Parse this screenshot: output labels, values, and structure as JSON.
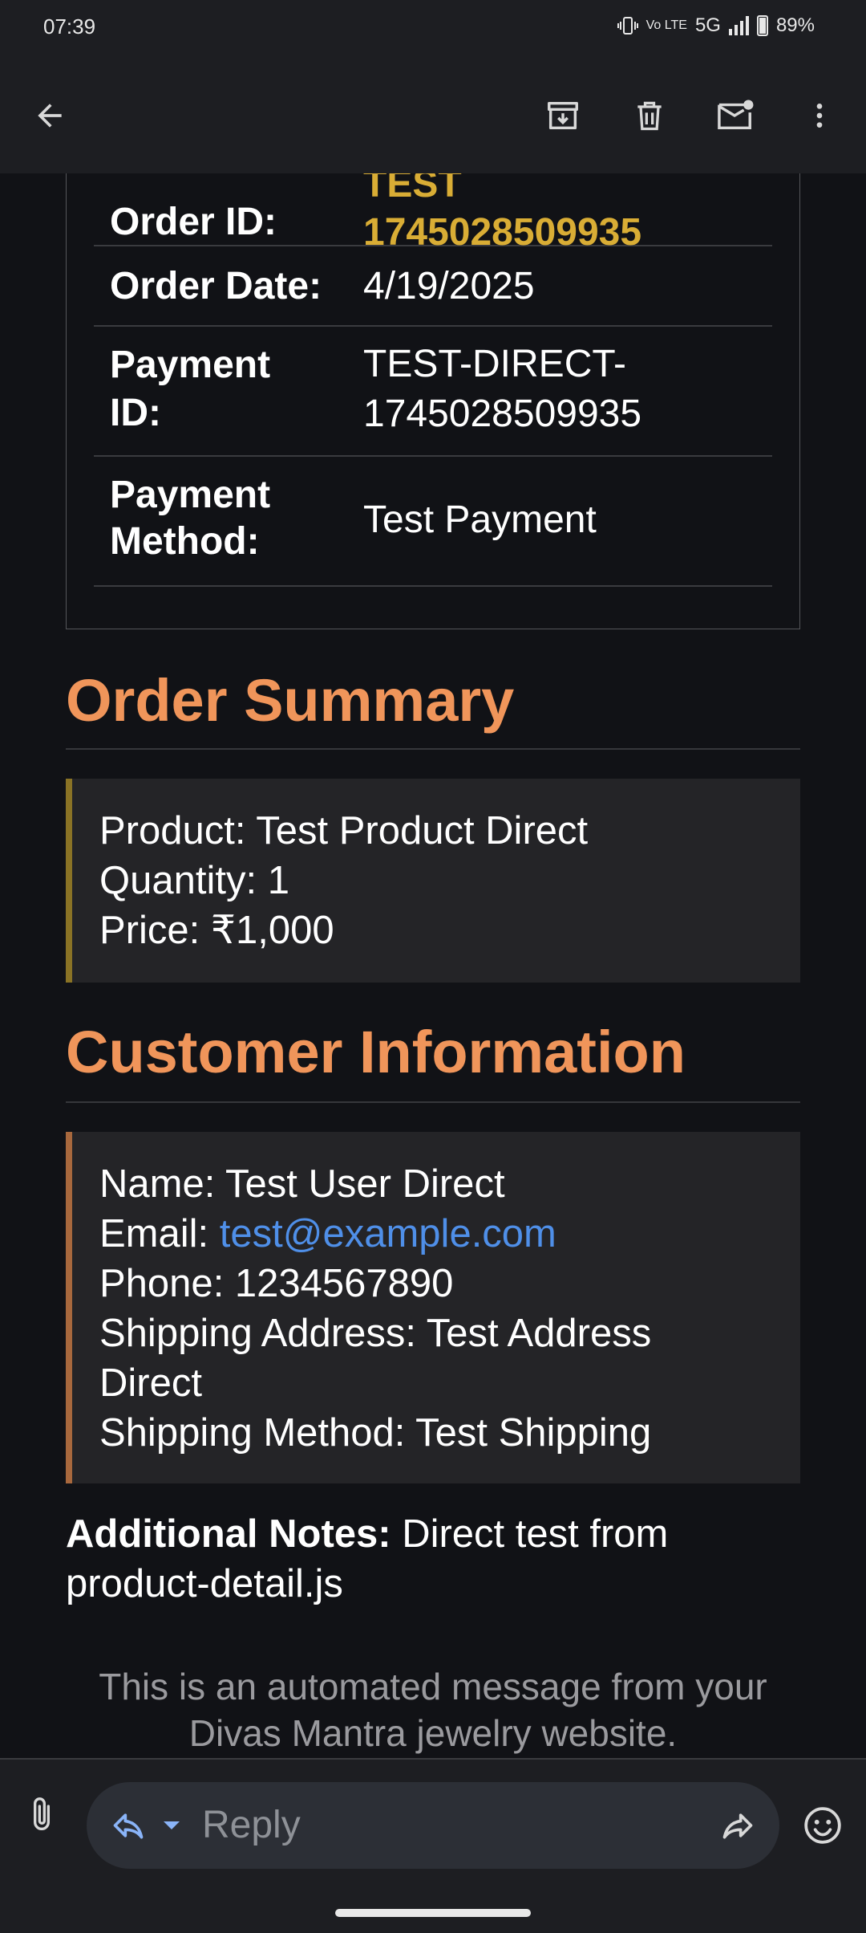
{
  "status_bar": {
    "time": "07:39",
    "network": "5G",
    "volte": "Vo LTE",
    "battery": "89%"
  },
  "app_bar": {
    "icons": [
      "back-arrow-icon",
      "archive-icon",
      "delete-icon",
      "mark-unread-icon",
      "more-vert-icon"
    ]
  },
  "order_details": {
    "rows": [
      {
        "label": "Order ID:",
        "value_line1": "TEST",
        "value_line2": "1745028509935"
      },
      {
        "label": "Order Date:",
        "value": "4/19/2025"
      },
      {
        "label_line1": "Payment",
        "label_line2": "ID:",
        "value_line1": "TEST-DIRECT-",
        "value_line2": "1745028509935"
      },
      {
        "label_line1": "Payment",
        "label_line2": "Method:",
        "value": "Test Payment"
      }
    ]
  },
  "order_summary": {
    "title": "Order Summary",
    "lines": [
      "Product: Test Product Direct",
      "Quantity: 1",
      "Price: ₹1,000"
    ]
  },
  "customer_info": {
    "title": "Customer Information",
    "name": "Name: Test User Direct",
    "email_label": "Email: ",
    "email": "test@example.com",
    "phone": "Phone: 1234567890",
    "address_line1": "Shipping Address: Test Address",
    "address_line2": "Direct",
    "shipping_method": "Shipping Method: Test Shipping"
  },
  "notes": {
    "label": "Additional Notes:",
    "text": " Direct test from product-detail.js"
  },
  "footer": {
    "message": "This is an automated message from your Divas Mantra jewelry website."
  },
  "reply_bar": {
    "placeholder": "Reply"
  }
}
